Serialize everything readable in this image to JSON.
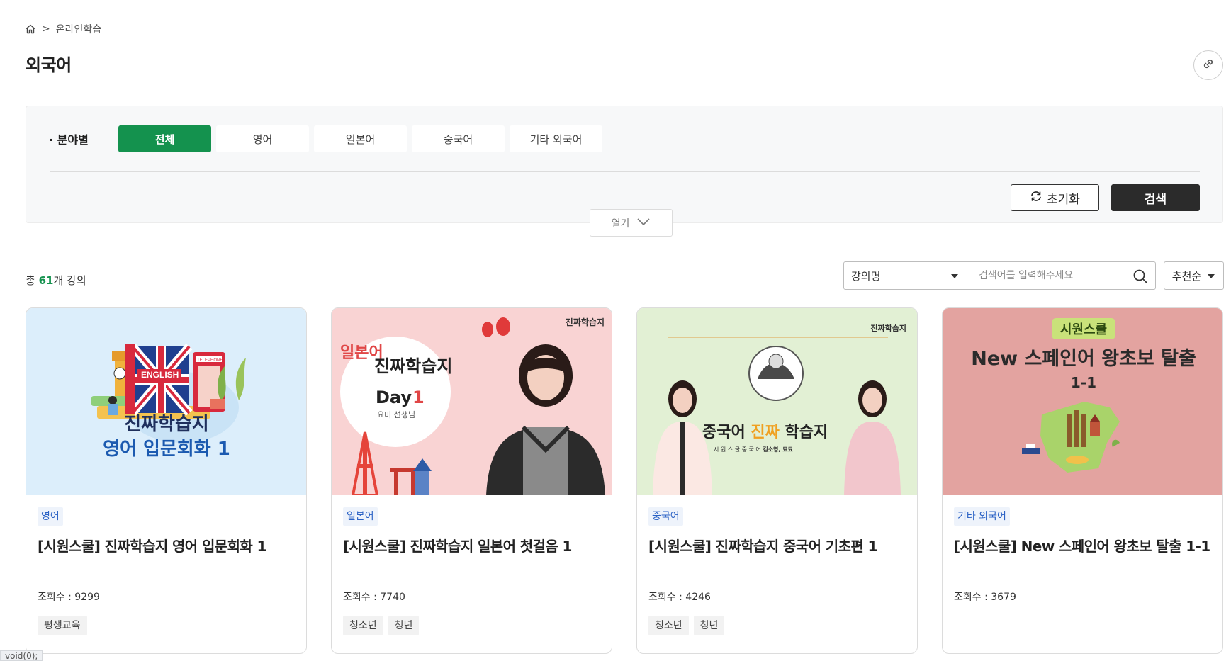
{
  "breadcrumb": {
    "separator": ">",
    "current": "온라인학습"
  },
  "page": {
    "title": "외국어"
  },
  "filter": {
    "label": "· 분야별",
    "chips": [
      "전체",
      "영어",
      "일본어",
      "중국어",
      "기타 외국어"
    ],
    "active_chip": "전체",
    "reset_label": "초기화",
    "search_label": "검색",
    "toggle_label": "열기"
  },
  "results": {
    "prefix": "총 ",
    "count": "61",
    "suffix": "개 강의"
  },
  "search": {
    "select_value": "강의명",
    "placeholder": "검색어를 입력해주세요"
  },
  "sort": {
    "value": "추천순"
  },
  "colors": {
    "accent": "#14924e",
    "dark_button": "#2b2b2b",
    "badge_text": "#2b62c5",
    "badge_bg": "#eef3fb"
  },
  "cards": [
    {
      "category": "영어",
      "title": "[시원스쿨] 진짜학습지 영어 입문회화 1",
      "views_label": "조회수 : ",
      "views": "9299",
      "tags": [
        "평생교육"
      ],
      "thumb": {
        "bg": "#dceefb",
        "line1": "진짜학습지",
        "line2": "영어 입문회화 1",
        "book_text": "ENGLISH",
        "booth_text": "TELEPHONE"
      }
    },
    {
      "category": "일본어",
      "title": "[시원스쿨] 진짜학습지 일본어 첫걸음 1",
      "views_label": "조회수 : ",
      "views": "7740",
      "tags": [
        "청소년",
        "청년"
      ],
      "thumb": {
        "bg": "#f9d3d3",
        "brand": "진짜학습지",
        "lang": "일본어",
        "headline": "진짜학습지",
        "day": "Day",
        "day_num": "1",
        "teacher": "요미 선생님"
      }
    },
    {
      "category": "중국어",
      "title": "[시원스쿨] 진짜학습지 중국어 기초편 1",
      "views_label": "조회수 : ",
      "views": "4246",
      "tags": [
        "청소년",
        "청년"
      ],
      "thumb": {
        "bg": "#e2f0d4",
        "brand": "진짜학습지",
        "headline_a": "중국어 ",
        "headline_b": "진짜",
        "headline_c": " 학습지",
        "sub_a": "시 원 스 쿨  중 국 어  ",
        "sub_b": "김소영, 묘묘"
      }
    },
    {
      "category": "기타 외국어",
      "title": "[시원스쿨] New 스페인어 왕초보 탈출 1-1",
      "views_label": "조회수 : ",
      "views": "3679",
      "tags": [],
      "thumb": {
        "bg": "#e3a3a0",
        "brand": "시원스쿨",
        "headline": "New 스페인어 왕초보 탈출",
        "sub": "1-1"
      }
    }
  ],
  "status_bar": {
    "text": "void(0);"
  }
}
